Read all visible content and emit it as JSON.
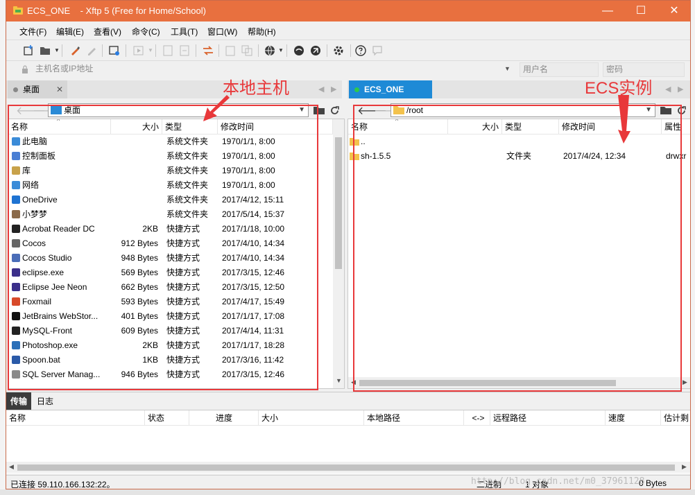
{
  "window": {
    "title": "ECS_ONE    - Xftp 5 (Free for Home/School)",
    "minimize": "—",
    "maximize": "☐",
    "close": "✕",
    "accent": "#e8703f"
  },
  "menu": [
    "文件(F)",
    "编辑(E)",
    "查看(V)",
    "命令(C)",
    "工具(T)",
    "窗口(W)",
    "帮助(H)"
  ],
  "toolbar_icons": [
    "new-session-icon",
    "open-folder-icon",
    "brush-icon",
    "pencil-icon",
    "properties-icon",
    "play-icon",
    "copy-file-icon",
    "paste-file-icon",
    "transfer-icon",
    "clipboard-icon",
    "duplicate-icon",
    "globe-icon",
    "xshell-icon",
    "xftp-icon",
    "gear-icon",
    "help-icon",
    "chat-icon"
  ],
  "address": {
    "host_placeholder": "主机名或IP地址",
    "user_placeholder": "用户名",
    "password_placeholder": "密码"
  },
  "local": {
    "tab": "桌面",
    "path": "桌面",
    "columns": [
      "名称",
      "大小",
      "类型",
      "修改时间"
    ],
    "files": [
      {
        "name": "此电脑",
        "size": "",
        "type": "系统文件夹",
        "modified": "1970/1/1, 8:00",
        "icon": "computer-icon"
      },
      {
        "name": "控制面板",
        "size": "",
        "type": "系统文件夹",
        "modified": "1970/1/1, 8:00",
        "icon": "control-panel-icon"
      },
      {
        "name": "库",
        "size": "",
        "type": "系统文件夹",
        "modified": "1970/1/1, 8:00",
        "icon": "library-icon"
      },
      {
        "name": "网络",
        "size": "",
        "type": "系统文件夹",
        "modified": "1970/1/1, 8:00",
        "icon": "network-icon"
      },
      {
        "name": "OneDrive",
        "size": "",
        "type": "系统文件夹",
        "modified": "2017/4/12, 15:11",
        "icon": "cloud-icon"
      },
      {
        "name": "小梦梦",
        "size": "",
        "type": "系统文件夹",
        "modified": "2017/5/14, 15:37",
        "icon": "user-icon"
      },
      {
        "name": "Acrobat Reader DC",
        "size": "2KB",
        "type": "快捷方式",
        "modified": "2017/1/18, 10:00",
        "icon": "acrobat-icon"
      },
      {
        "name": "Cocos",
        "size": "912 Bytes",
        "type": "快捷方式",
        "modified": "2017/4/10, 14:34",
        "icon": "cocos-icon"
      },
      {
        "name": "Cocos Studio",
        "size": "948 Bytes",
        "type": "快捷方式",
        "modified": "2017/4/10, 14:34",
        "icon": "cocos-studio-icon"
      },
      {
        "name": "eclipse.exe",
        "size": "569 Bytes",
        "type": "快捷方式",
        "modified": "2017/3/15, 12:46",
        "icon": "eclipse-icon"
      },
      {
        "name": "Eclipse Jee Neon",
        "size": "662 Bytes",
        "type": "快捷方式",
        "modified": "2017/3/15, 12:50",
        "icon": "eclipse-icon"
      },
      {
        "name": "Foxmail",
        "size": "593 Bytes",
        "type": "快捷方式",
        "modified": "2017/4/17, 15:49",
        "icon": "foxmail-icon"
      },
      {
        "name": "JetBrains WebStor...",
        "size": "401 Bytes",
        "type": "快捷方式",
        "modified": "2017/1/17, 17:08",
        "icon": "webstorm-icon"
      },
      {
        "name": "MySQL-Front",
        "size": "609 Bytes",
        "type": "快捷方式",
        "modified": "2017/4/14, 11:31",
        "icon": "mysql-icon"
      },
      {
        "name": "Photoshop.exe",
        "size": "2KB",
        "type": "快捷方式",
        "modified": "2017/1/17, 18:28",
        "icon": "photoshop-icon"
      },
      {
        "name": "Spoon.bat",
        "size": "1KB",
        "type": "快捷方式",
        "modified": "2017/3/16, 11:42",
        "icon": "spoon-icon"
      },
      {
        "name": "SQL Server Manag...",
        "size": "946 Bytes",
        "type": "快捷方式",
        "modified": "2017/3/15, 12:46",
        "icon": "sql-server-icon"
      }
    ]
  },
  "remote": {
    "tab": "ECS_ONE",
    "path": "/root",
    "columns": [
      "名称",
      "大小",
      "类型",
      "修改时间",
      "属性"
    ],
    "files": [
      {
        "name": "..",
        "size": "",
        "type": "",
        "modified": "",
        "attr": "",
        "icon": "parent-folder-icon"
      },
      {
        "name": "sh-1.5.5",
        "size": "",
        "type": "文件夹",
        "modified": "2017/4/24, 12:34",
        "attr": "drwxr",
        "icon": "folder-icon"
      }
    ]
  },
  "annotations": {
    "local": "本地主机",
    "remote": "ECS实例"
  },
  "lower_tabs": [
    "传输",
    "日志"
  ],
  "transfer_columns": [
    "名称",
    "状态",
    "进度",
    "大小",
    "本地路径",
    "<->",
    "远程路径",
    "速度",
    "估计剩"
  ],
  "status": {
    "connected": "已连接 59.110.166.132:22。",
    "mode": "二进制",
    "objects": "1 对象",
    "size": "0 Bytes"
  },
  "watermark": "http://blog.csdn.net/m0_37961128"
}
